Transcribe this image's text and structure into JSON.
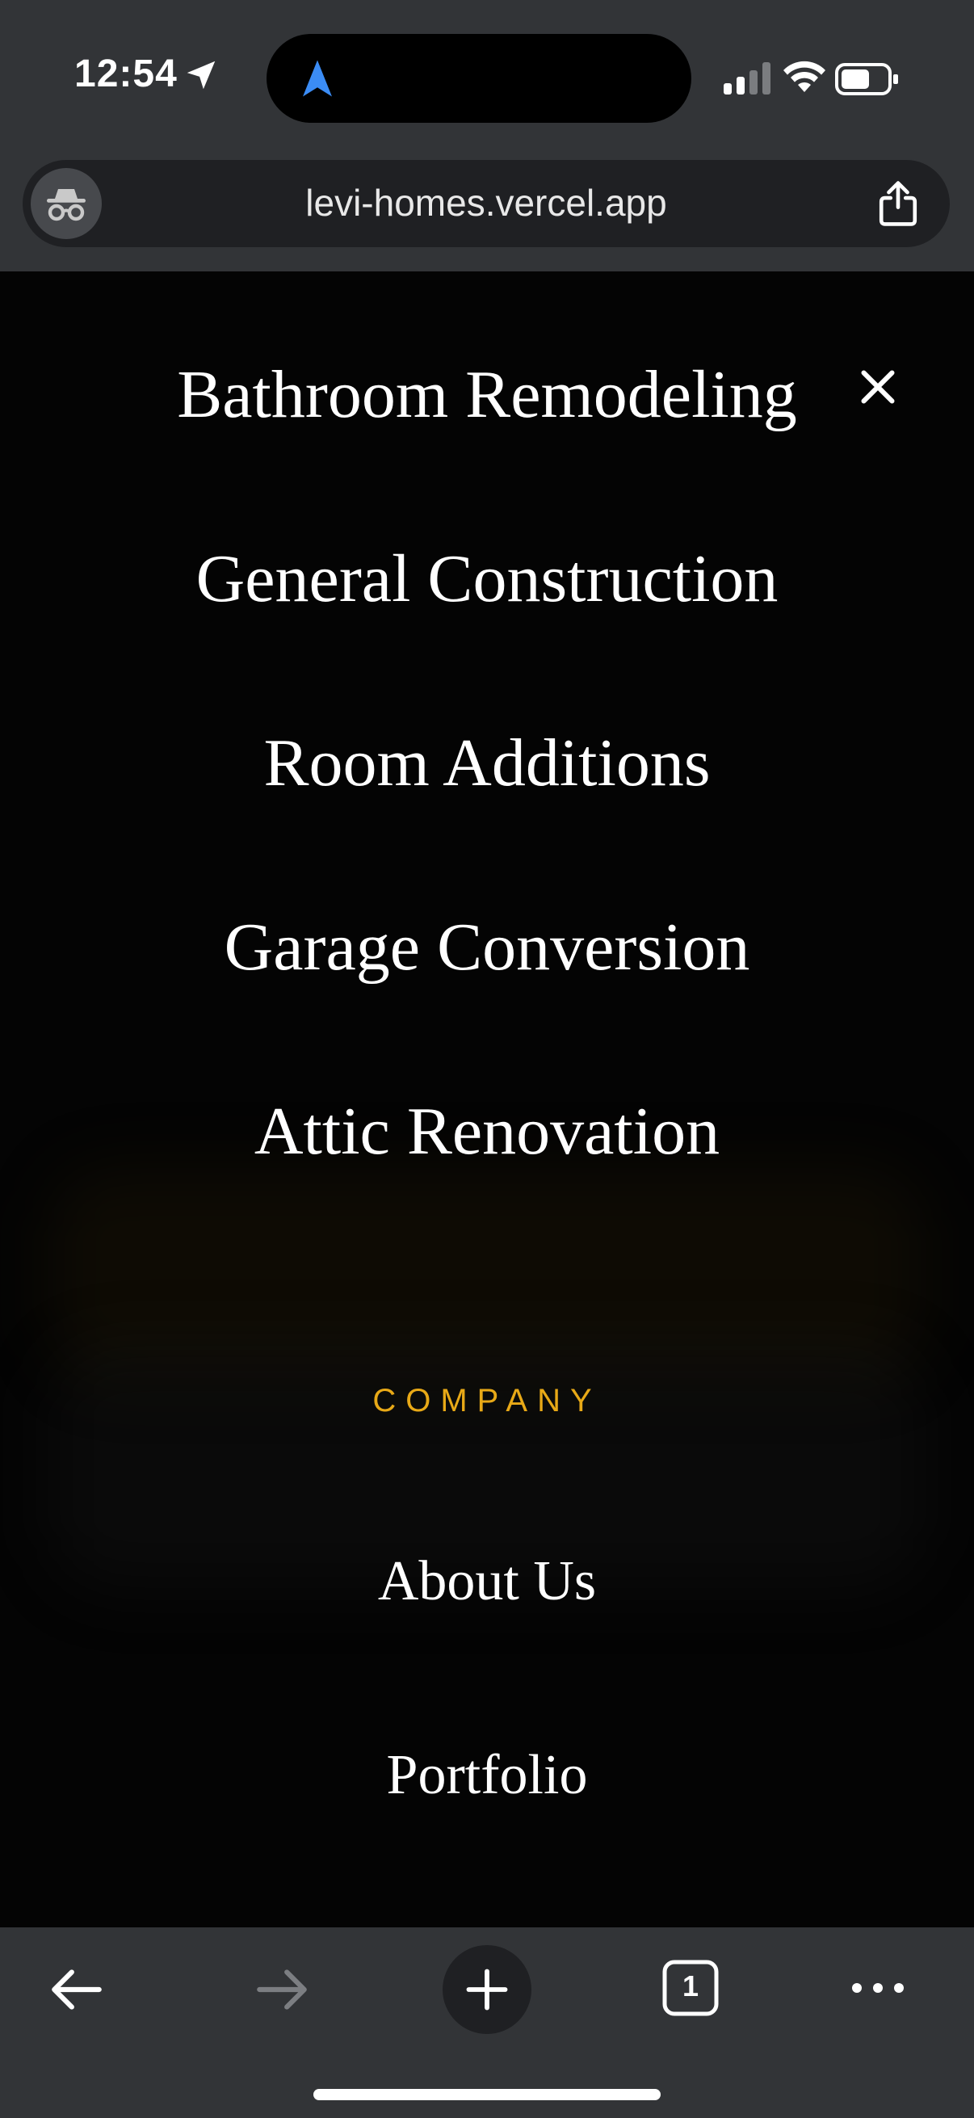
{
  "status_bar": {
    "time": "12:54"
  },
  "browser": {
    "url": "levi-homes.vercel.app"
  },
  "menu": {
    "services": [
      "Bathroom Remodeling",
      "General Construction",
      "Room Additions",
      "Garage Conversion",
      "Attic Renovation"
    ],
    "company_label": "COMPANY",
    "company_links": [
      "About Us",
      "Portfolio"
    ]
  },
  "toolbar": {
    "tab_count": "1"
  },
  "colors": {
    "accent": "#e8a917",
    "chrome": "#323437",
    "background": "#040404"
  }
}
